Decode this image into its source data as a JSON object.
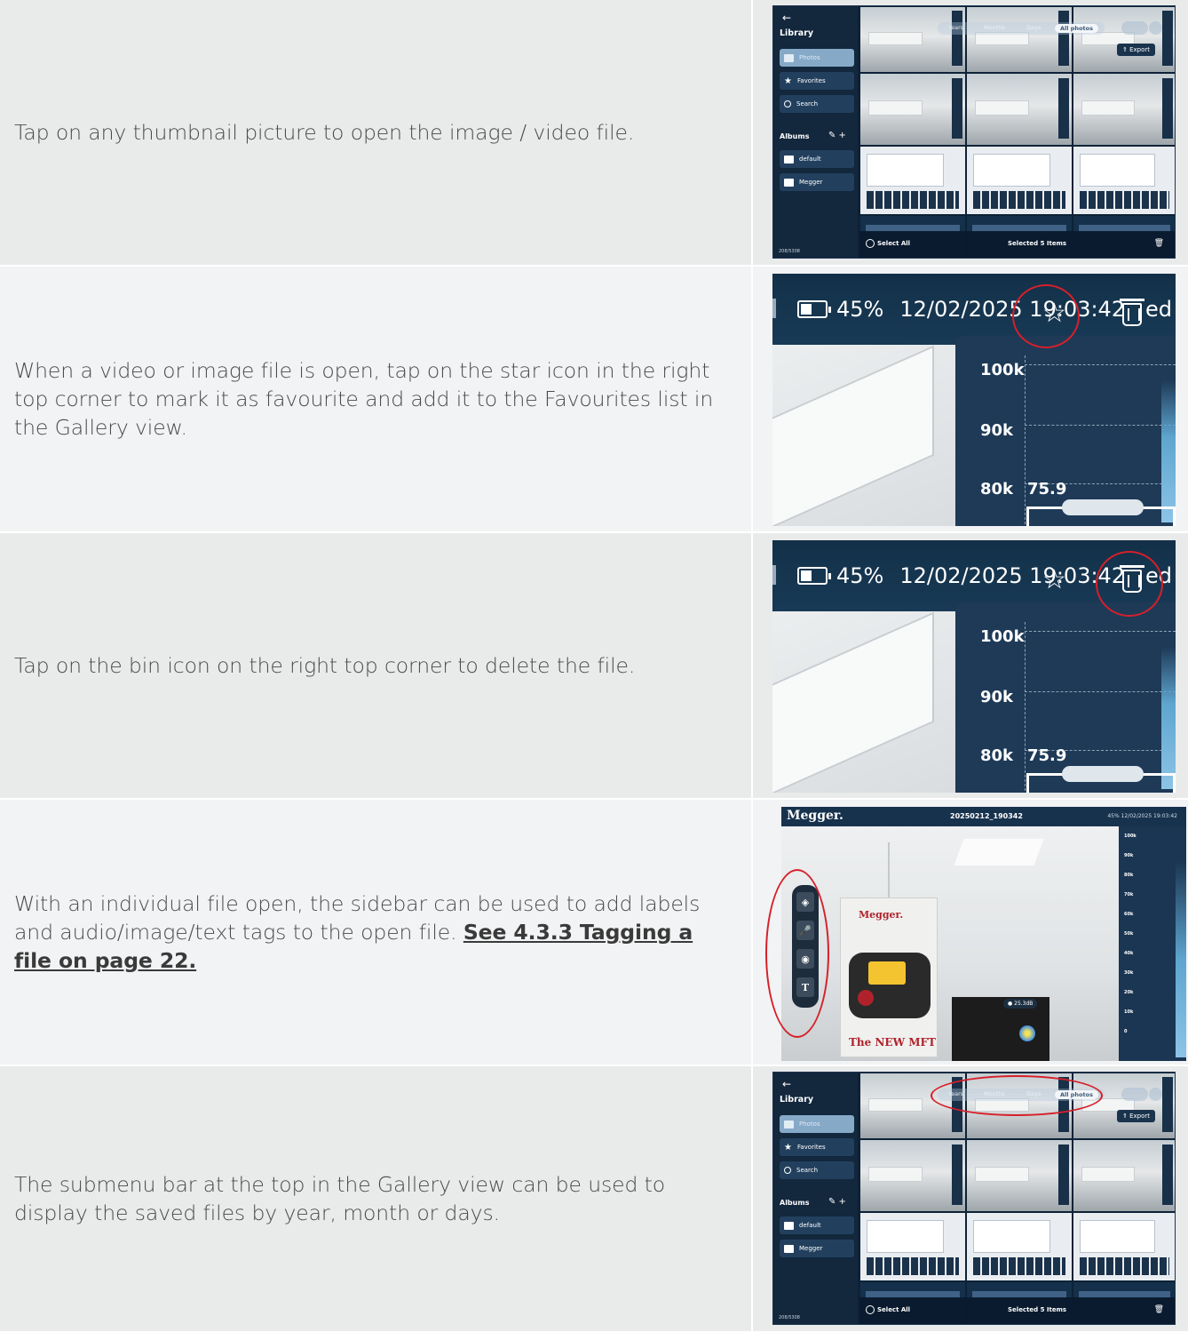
{
  "rows": [
    {
      "text": "Tap on any thumbnail picture to open the image / video file."
    },
    {
      "text": "When a video or image file is open, tap on the star icon in the right top corner to mark it as favourite and add it to the Favourites list in the Gallery view."
    },
    {
      "text": "Tap on the bin icon on the right top corner to delete the file."
    },
    {
      "text": "With an individual file open, the sidebar can be used to add labels and audio/image/text tags to the open file. ",
      "link": "See 4.3.3 Tagging a file on page 22."
    },
    {
      "text": "The submenu bar at the top in the Gallery view can be used to display the saved files by year, month or days."
    }
  ],
  "gallery": {
    "back": "←",
    "library": "Library",
    "items": [
      "Photos",
      "Favorites",
      "Search"
    ],
    "albums": "Albums",
    "album_tools": "✎ +",
    "album_items": [
      "default",
      "Megger"
    ],
    "count": "208/5308",
    "submenu": [
      "Years",
      "Months",
      "Days",
      "All photos"
    ],
    "export": "⇑ Export",
    "select_all": "Select All",
    "selected": "Selected 5 Items",
    "bin": "🗑"
  },
  "device": {
    "battery": "45%",
    "datetime": "12/02/2025 19:03:42",
    "suffix": "ed",
    "star": "☆",
    "ticks": [
      "100k",
      "90k",
      "80k"
    ],
    "value": "75.9"
  },
  "tagging": {
    "logo": "Megger.",
    "filename": "20250212_190342",
    "status": "45%  12/02/2025 19:03:42",
    "box_brand": "Megger.",
    "box_new": "The NEW MFT",
    "db": "● 25.3dB",
    "chart_ticks": [
      "100k",
      "90k",
      "80k",
      "70k",
      "60k",
      "50k",
      "40k",
      "30k",
      "20k",
      "10k",
      "0"
    ],
    "sidebar_buttons": [
      "◈",
      "🎤",
      "◉",
      "T"
    ]
  }
}
